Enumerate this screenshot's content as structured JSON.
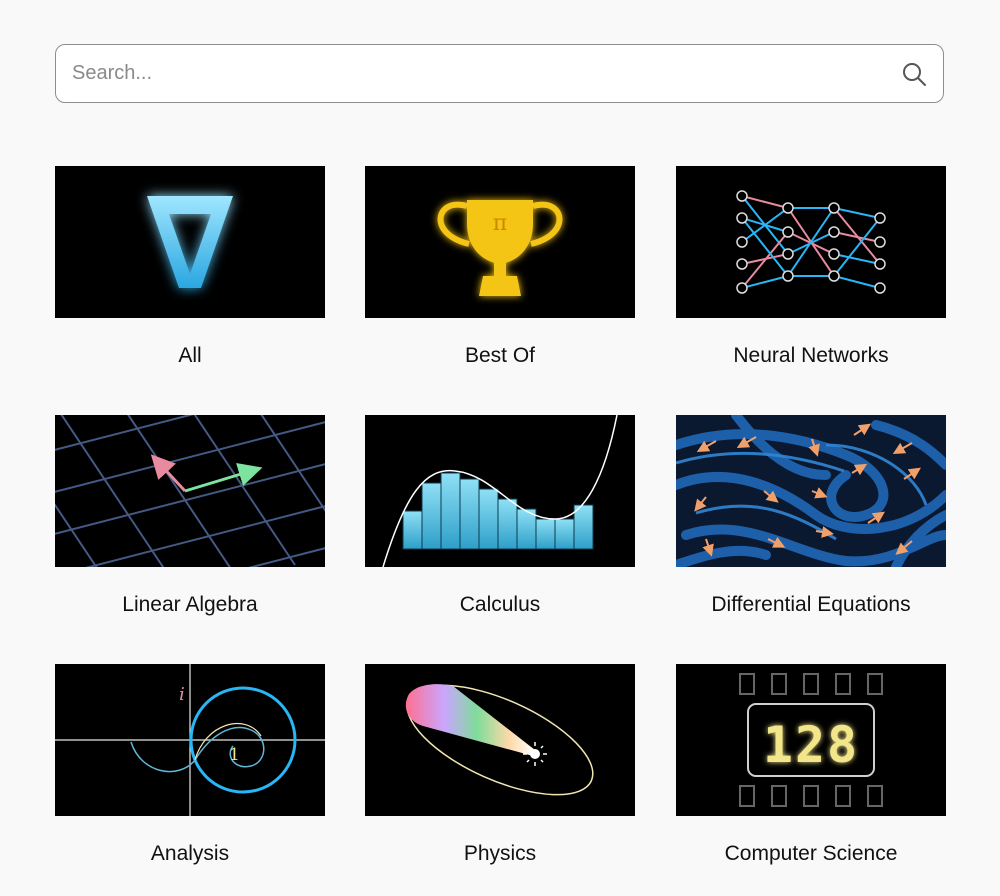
{
  "search": {
    "placeholder": "Search...",
    "value": ""
  },
  "icons": {
    "search": "search-icon",
    "topics": [
      "logo-a-icon",
      "trophy-pi-icon",
      "neural-network-icon",
      "vector-grid-icon",
      "riemann-sum-icon",
      "vector-field-icon",
      "complex-spiral-icon",
      "orbit-ellipse-icon",
      "digital-counter-icon"
    ]
  },
  "topics": [
    {
      "label": "All"
    },
    {
      "label": "Best Of",
      "symbol": "π"
    },
    {
      "label": "Neural Networks"
    },
    {
      "label": "Linear Algebra"
    },
    {
      "label": "Calculus"
    },
    {
      "label": "Differential Equations"
    },
    {
      "label": "Analysis",
      "axis_label": "i",
      "marker": "1"
    },
    {
      "label": "Physics"
    },
    {
      "label": "Computer Science",
      "counter": "128"
    }
  ],
  "colors": {
    "accent_blue": "#29b6f6",
    "gold": "#f5c518",
    "pink": "#e88aa0",
    "green": "#7ee3a0",
    "orange": "#f2a06a",
    "counter": "#f2e58a"
  }
}
